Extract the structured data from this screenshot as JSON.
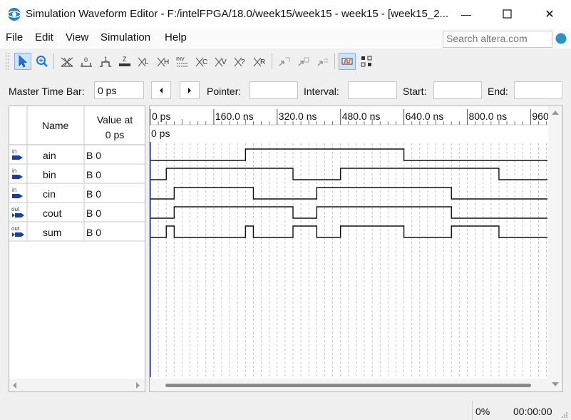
{
  "window": {
    "title": "Simulation Waveform Editor - F:/intelFPGA/18.0/week15/week15 - week15 - [week15_2...",
    "minimize_glyph": "—",
    "close_glyph": "✕"
  },
  "menu": [
    "File",
    "Edit",
    "View",
    "Simulation",
    "Help"
  ],
  "search": {
    "placeholder": "Search altera.com"
  },
  "toolbar": {
    "icons": [
      "selection-tool",
      "zoom-tool",
      "forcing-unknown",
      "forcing-low",
      "forcing-high",
      "high-impedance",
      "weak-low",
      "weak-high",
      "invert",
      "count-value",
      "clock",
      "arbitrary-value",
      "random-values",
      "snap-to-grid",
      "sort",
      "group",
      "overwrite-clock",
      "grid-settings"
    ],
    "labels": {
      "forcing_low": "0",
      "forcing_high": "1",
      "high_impedance": "Z",
      "weak_low": "L",
      "weak_high": "H",
      "invert": "INV",
      "clock": "C",
      "count": "V",
      "arbitrary": "?",
      "random": "R"
    }
  },
  "timebar": {
    "master_label": "Master Time Bar:",
    "master_value": "0 ps",
    "pointer_label": "Pointer:",
    "pointer_value": "",
    "interval_label": "Interval:",
    "interval_value": "",
    "start_label": "Start:",
    "start_value": "",
    "end_label": "End:",
    "end_value": ""
  },
  "signal_table": {
    "header_name": "Name",
    "header_value_line1": "Value at",
    "header_value_line2": "0 ps",
    "rows": [
      {
        "dir": "in",
        "name": "ain",
        "value": "B 0"
      },
      {
        "dir": "in",
        "name": "bin",
        "value": "B 0"
      },
      {
        "dir": "in",
        "name": "cin",
        "value": "B 0"
      },
      {
        "dir": "out",
        "name": "cout",
        "value": "B 0"
      },
      {
        "dir": "out",
        "name": "sum",
        "value": "B 0"
      }
    ]
  },
  "waveform": {
    "ticks": [
      "0 ps",
      "160.0 ns",
      "320.0 ns",
      "480.0 ns",
      "640.0 ns",
      "800.0 ns",
      "960.0 ns"
    ],
    "cursor_label": "0 ps",
    "signals": [
      {
        "name": "ain",
        "edges_ns": [
          0,
          240,
          640
        ],
        "init": 0
      },
      {
        "name": "bin",
        "edges_ns": [
          0,
          40,
          360,
          480,
          880
        ],
        "init": 0
      },
      {
        "name": "cin",
        "edges_ns": [
          0,
          60,
          260,
          420,
          760
        ],
        "init": 0
      },
      {
        "name": "cout",
        "edges_ns": [
          0,
          60,
          360,
          420,
          760
        ],
        "init": 0
      },
      {
        "name": "sum",
        "edges_ns": [
          0,
          40,
          60,
          240,
          260,
          360,
          420,
          480,
          640,
          760,
          880
        ],
        "init": 0
      }
    ]
  },
  "status": {
    "percent": "0%",
    "elapsed": "00:00:00"
  }
}
